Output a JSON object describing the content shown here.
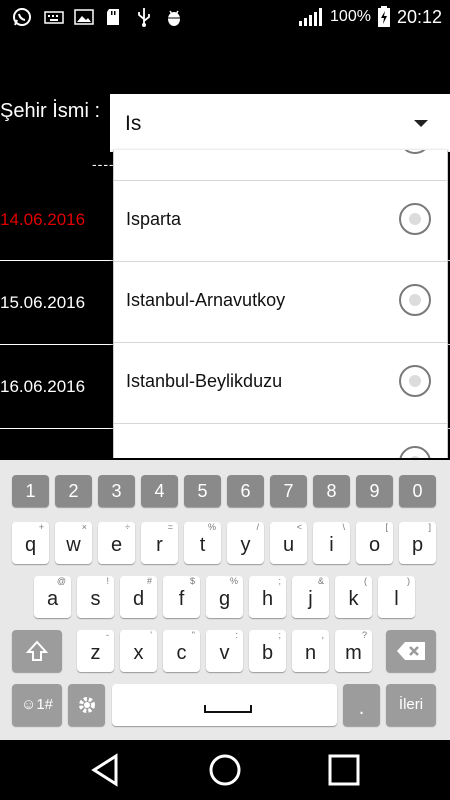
{
  "status_bar": {
    "battery_percent": "100%",
    "time": "20:12",
    "icons": [
      "whatsapp-icon",
      "keyboard-icon",
      "image-icon",
      "sd-card-icon",
      "usb-icon",
      "android-debug-icon",
      "signal-icon",
      "battery-icon"
    ]
  },
  "form": {
    "city_label": "Şehir İsmi :",
    "selected_city": "Is",
    "dashes": "-----"
  },
  "dates": [
    {
      "date": "14.06.2016",
      "color": "#e00000"
    },
    {
      "date": "15.06.2016",
      "color": "#ffffff"
    },
    {
      "date": "16.06.2016",
      "color": "#ffffff"
    }
  ],
  "dropdown": {
    "options": [
      "Isparta",
      "Istanbul-Arnavutkoy",
      "Istanbul-Beylikduzu"
    ]
  },
  "keyboard": {
    "number_row": [
      "1",
      "2",
      "3",
      "4",
      "5",
      "6",
      "7",
      "8",
      "9",
      "0"
    ],
    "row1": [
      {
        "k": "q",
        "h": "+"
      },
      {
        "k": "w",
        "h": "×"
      },
      {
        "k": "e",
        "h": "÷"
      },
      {
        "k": "r",
        "h": "="
      },
      {
        "k": "t",
        "h": "%"
      },
      {
        "k": "y",
        "h": "/"
      },
      {
        "k": "u",
        "h": "<"
      },
      {
        "k": "i",
        "h": "\\"
      },
      {
        "k": "o",
        "h": "["
      },
      {
        "k": "p",
        "h": "]"
      }
    ],
    "row2": [
      {
        "k": "a",
        "h": "@"
      },
      {
        "k": "s",
        "h": "!"
      },
      {
        "k": "d",
        "h": "#"
      },
      {
        "k": "f",
        "h": "$"
      },
      {
        "k": "g",
        "h": "%"
      },
      {
        "k": "h",
        "h": ";"
      },
      {
        "k": "j",
        "h": "&"
      },
      {
        "k": "k",
        "h": "("
      },
      {
        "k": "l",
        "h": ")"
      }
    ],
    "row3": [
      {
        "k": "z",
        "h": "-"
      },
      {
        "k": "x",
        "h": "'"
      },
      {
        "k": "c",
        "h": "\""
      },
      {
        "k": "v",
        "h": ":"
      },
      {
        "k": "b",
        "h": ";"
      },
      {
        "k": "n",
        "h": ","
      },
      {
        "k": "m",
        "h": "?"
      }
    ],
    "symbols_key": "☺1#",
    "period_key": ".",
    "enter_key": "İleri"
  },
  "accent_colors": {
    "red_date": "#e00000",
    "keyboard_bg": "#e8e8e8",
    "number_key": "#8a8a8a"
  }
}
